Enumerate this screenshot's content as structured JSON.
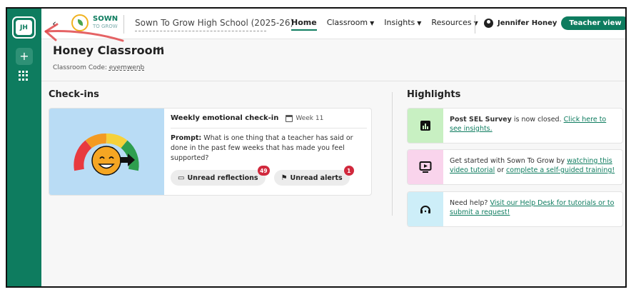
{
  "rail": {
    "avatar_initials": "JH",
    "add_label": "+"
  },
  "topbar": {
    "back_label": "‹",
    "logo_text": "SOWN",
    "logo_subtext": "TO GROW",
    "school": "Sown To Grow High School (2025-26)",
    "nav": [
      {
        "label": "Home",
        "caret": ""
      },
      {
        "label": "Classroom",
        "caret": "▼"
      },
      {
        "label": "Insights",
        "caret": "▼"
      },
      {
        "label": "Resources",
        "caret": "▼"
      }
    ],
    "user_name": "Jennifer Honey",
    "teacher_view_label": "Teacher view",
    "user_caret": "▼"
  },
  "header": {
    "title": "Honey Classroom",
    "more_label": "···",
    "code_label": "Classroom Code:",
    "code_value": "eyemwenb"
  },
  "checkins": {
    "heading": "Check-ins",
    "card": {
      "title": "Weekly emotional check-in",
      "week": "Week 11",
      "prompt_label": "Prompt:",
      "prompt_text": "What is one thing that a teacher has said or done in the past few weeks that has made you feel supported?",
      "reflections_label": "Unread reflections",
      "reflections_count": "49",
      "alerts_label": "Unread alerts",
      "alerts_count": "1"
    }
  },
  "highlights": {
    "heading": "Highlights",
    "items": [
      {
        "bold": "Post SEL Survey",
        "text": " is now closed. ",
        "link1": "Click here to see insights.",
        "text2": "",
        "link2": "",
        "icon": "bar-chart-icon",
        "color": "#c8f0c2"
      },
      {
        "bold": "",
        "text": "Get started with Sown To Grow by ",
        "link1": "watching this video tutorial",
        "text2": " or ",
        "link2": "complete a self-guided training!",
        "icon": "video-icon",
        "color": "#f9d4ec"
      },
      {
        "bold": "",
        "text": "Need help? ",
        "link1": "Visit our Help Desk for tutorials or to submit a request!",
        "text2": "",
        "link2": "",
        "icon": "headset-icon",
        "color": "#cdeef8"
      }
    ]
  },
  "colors": {
    "brand": "#0e7c5f",
    "alert": "#d1293d"
  }
}
